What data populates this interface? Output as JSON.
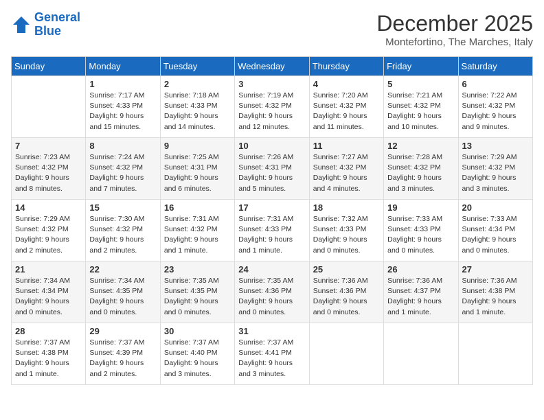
{
  "logo": {
    "line1": "General",
    "line2": "Blue"
  },
  "title": "December 2025",
  "location": "Montefortino, The Marches, Italy",
  "days_of_week": [
    "Sunday",
    "Monday",
    "Tuesday",
    "Wednesday",
    "Thursday",
    "Friday",
    "Saturday"
  ],
  "weeks": [
    [
      {
        "day": "",
        "sunrise": "",
        "sunset": "",
        "daylight": ""
      },
      {
        "day": "1",
        "sunrise": "Sunrise: 7:17 AM",
        "sunset": "Sunset: 4:33 PM",
        "daylight": "Daylight: 9 hours and 15 minutes."
      },
      {
        "day": "2",
        "sunrise": "Sunrise: 7:18 AM",
        "sunset": "Sunset: 4:33 PM",
        "daylight": "Daylight: 9 hours and 14 minutes."
      },
      {
        "day": "3",
        "sunrise": "Sunrise: 7:19 AM",
        "sunset": "Sunset: 4:32 PM",
        "daylight": "Daylight: 9 hours and 12 minutes."
      },
      {
        "day": "4",
        "sunrise": "Sunrise: 7:20 AM",
        "sunset": "Sunset: 4:32 PM",
        "daylight": "Daylight: 9 hours and 11 minutes."
      },
      {
        "day": "5",
        "sunrise": "Sunrise: 7:21 AM",
        "sunset": "Sunset: 4:32 PM",
        "daylight": "Daylight: 9 hours and 10 minutes."
      },
      {
        "day": "6",
        "sunrise": "Sunrise: 7:22 AM",
        "sunset": "Sunset: 4:32 PM",
        "daylight": "Daylight: 9 hours and 9 minutes."
      }
    ],
    [
      {
        "day": "7",
        "sunrise": "Sunrise: 7:23 AM",
        "sunset": "Sunset: 4:32 PM",
        "daylight": "Daylight: 9 hours and 8 minutes."
      },
      {
        "day": "8",
        "sunrise": "Sunrise: 7:24 AM",
        "sunset": "Sunset: 4:32 PM",
        "daylight": "Daylight: 9 hours and 7 minutes."
      },
      {
        "day": "9",
        "sunrise": "Sunrise: 7:25 AM",
        "sunset": "Sunset: 4:31 PM",
        "daylight": "Daylight: 9 hours and 6 minutes."
      },
      {
        "day": "10",
        "sunrise": "Sunrise: 7:26 AM",
        "sunset": "Sunset: 4:31 PM",
        "daylight": "Daylight: 9 hours and 5 minutes."
      },
      {
        "day": "11",
        "sunrise": "Sunrise: 7:27 AM",
        "sunset": "Sunset: 4:32 PM",
        "daylight": "Daylight: 9 hours and 4 minutes."
      },
      {
        "day": "12",
        "sunrise": "Sunrise: 7:28 AM",
        "sunset": "Sunset: 4:32 PM",
        "daylight": "Daylight: 9 hours and 3 minutes."
      },
      {
        "day": "13",
        "sunrise": "Sunrise: 7:29 AM",
        "sunset": "Sunset: 4:32 PM",
        "daylight": "Daylight: 9 hours and 3 minutes."
      }
    ],
    [
      {
        "day": "14",
        "sunrise": "Sunrise: 7:29 AM",
        "sunset": "Sunset: 4:32 PM",
        "daylight": "Daylight: 9 hours and 2 minutes."
      },
      {
        "day": "15",
        "sunrise": "Sunrise: 7:30 AM",
        "sunset": "Sunset: 4:32 PM",
        "daylight": "Daylight: 9 hours and 2 minutes."
      },
      {
        "day": "16",
        "sunrise": "Sunrise: 7:31 AM",
        "sunset": "Sunset: 4:32 PM",
        "daylight": "Daylight: 9 hours and 1 minute."
      },
      {
        "day": "17",
        "sunrise": "Sunrise: 7:31 AM",
        "sunset": "Sunset: 4:33 PM",
        "daylight": "Daylight: 9 hours and 1 minute."
      },
      {
        "day": "18",
        "sunrise": "Sunrise: 7:32 AM",
        "sunset": "Sunset: 4:33 PM",
        "daylight": "Daylight: 9 hours and 0 minutes."
      },
      {
        "day": "19",
        "sunrise": "Sunrise: 7:33 AM",
        "sunset": "Sunset: 4:33 PM",
        "daylight": "Daylight: 9 hours and 0 minutes."
      },
      {
        "day": "20",
        "sunrise": "Sunrise: 7:33 AM",
        "sunset": "Sunset: 4:34 PM",
        "daylight": "Daylight: 9 hours and 0 minutes."
      }
    ],
    [
      {
        "day": "21",
        "sunrise": "Sunrise: 7:34 AM",
        "sunset": "Sunset: 4:34 PM",
        "daylight": "Daylight: 9 hours and 0 minutes."
      },
      {
        "day": "22",
        "sunrise": "Sunrise: 7:34 AM",
        "sunset": "Sunset: 4:35 PM",
        "daylight": "Daylight: 9 hours and 0 minutes."
      },
      {
        "day": "23",
        "sunrise": "Sunrise: 7:35 AM",
        "sunset": "Sunset: 4:35 PM",
        "daylight": "Daylight: 9 hours and 0 minutes."
      },
      {
        "day": "24",
        "sunrise": "Sunrise: 7:35 AM",
        "sunset": "Sunset: 4:36 PM",
        "daylight": "Daylight: 9 hours and 0 minutes."
      },
      {
        "day": "25",
        "sunrise": "Sunrise: 7:36 AM",
        "sunset": "Sunset: 4:36 PM",
        "daylight": "Daylight: 9 hours and 0 minutes."
      },
      {
        "day": "26",
        "sunrise": "Sunrise: 7:36 AM",
        "sunset": "Sunset: 4:37 PM",
        "daylight": "Daylight: 9 hours and 1 minute."
      },
      {
        "day": "27",
        "sunrise": "Sunrise: 7:36 AM",
        "sunset": "Sunset: 4:38 PM",
        "daylight": "Daylight: 9 hours and 1 minute."
      }
    ],
    [
      {
        "day": "28",
        "sunrise": "Sunrise: 7:37 AM",
        "sunset": "Sunset: 4:38 PM",
        "daylight": "Daylight: 9 hours and 1 minute."
      },
      {
        "day": "29",
        "sunrise": "Sunrise: 7:37 AM",
        "sunset": "Sunset: 4:39 PM",
        "daylight": "Daylight: 9 hours and 2 minutes."
      },
      {
        "day": "30",
        "sunrise": "Sunrise: 7:37 AM",
        "sunset": "Sunset: 4:40 PM",
        "daylight": "Daylight: 9 hours and 3 minutes."
      },
      {
        "day": "31",
        "sunrise": "Sunrise: 7:37 AM",
        "sunset": "Sunset: 4:41 PM",
        "daylight": "Daylight: 9 hours and 3 minutes."
      },
      {
        "day": "",
        "sunrise": "",
        "sunset": "",
        "daylight": ""
      },
      {
        "day": "",
        "sunrise": "",
        "sunset": "",
        "daylight": ""
      },
      {
        "day": "",
        "sunrise": "",
        "sunset": "",
        "daylight": ""
      }
    ]
  ]
}
